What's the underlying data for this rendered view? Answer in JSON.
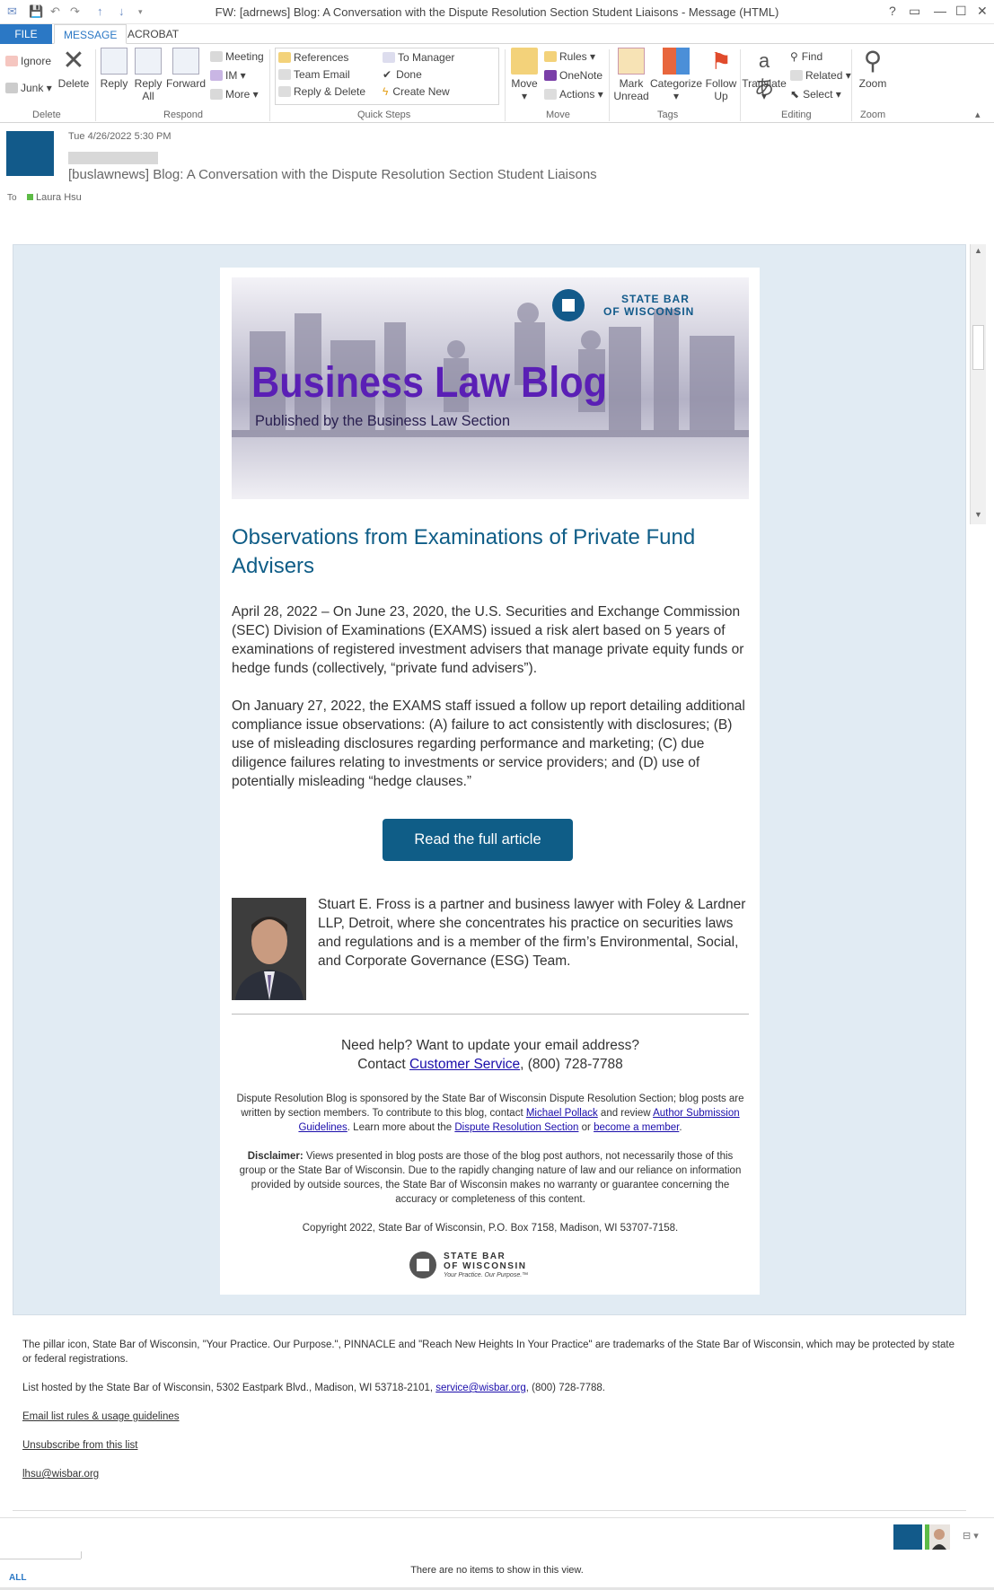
{
  "window": {
    "title": "FW: [adrnews] Blog: A Conversation with the Dispute Resolution Section Student Liaisons - Message (HTML)",
    "controls": [
      "?",
      "▭",
      "—",
      "☐",
      "✕"
    ]
  },
  "tabs": {
    "file": "FILE",
    "message": "MESSAGE",
    "acrobat": "ACROBAT"
  },
  "ribbon": {
    "delete": {
      "ignore": "Ignore",
      "junk": "Junk",
      "delete": "Delete",
      "group": "Delete"
    },
    "respond": {
      "reply": "Reply",
      "reply_all": "Reply All",
      "forward": "Forward",
      "meeting": "Meeting",
      "im": "IM",
      "more": "More",
      "group": "Respond"
    },
    "quick_steps": {
      "items": [
        "References",
        "Team Email",
        "Reply & Delete",
        "To Manager",
        "Done",
        "Create New"
      ],
      "group": "Quick Steps"
    },
    "move": {
      "move": "Move",
      "rules": "Rules",
      "onenote": "OneNote",
      "actions": "Actions",
      "group": "Move"
    },
    "tags": {
      "mark_unread": "Mark Unread",
      "categorize": "Categorize",
      "follow_up": "Follow Up",
      "group": "Tags"
    },
    "editing": {
      "translate": "Translate",
      "find": "Find",
      "related": "Related",
      "select": "Select",
      "group": "Editing"
    },
    "zoom": {
      "zoom": "Zoom",
      "group": "Zoom"
    }
  },
  "message": {
    "date": "Tue 4/26/2022 5:30 PM",
    "subject": "[buslawnews] Blog: A Conversation with the Dispute Resolution Section Student Liaisons",
    "to_label": "To",
    "to": "Laura Hsu"
  },
  "banner": {
    "org_line1": "STATE BAR",
    "org_line2": "OF WISCONSIN",
    "title": "Business Law Blog",
    "subtitle": "Published by the Business Law Section"
  },
  "article": {
    "headline": "Observations from Examinations of Private Fund Advisers",
    "p1": "April 28, 2022 – On June 23, 2020, the U.S. Securities and Exchange Commission (SEC) Division of Examinations (EXAMS) issued a risk alert based on 5 years of examinations of registered investment advisers that manage private equity funds or hedge funds (collectively, “private fund advisers”).",
    "p2": "On January 27, 2022, the EXAMS staff issued a follow up report detailing additional compliance issue observations: (A) failure to act consistently with disclosures; (B) use of misleading disclosures regarding performance and marketing; (C) due diligence failures relating to investments or service providers; and (D) use of potentially misleading “hedge clauses.”",
    "cta": "Read the full article",
    "author_bio": "Stuart E. Fross is a partner and business lawyer with Foley & Lardner LLP, Detroit, where she concentrates his practice on securities laws and regulations and is a member of the firm’s Environmental, Social, and Corporate Governance (ESG) Team."
  },
  "footer": {
    "help_line1": "Need help? Want to update your email address?",
    "help_contact": "Contact ",
    "help_link": "Customer Service",
    "help_phone": ", (800) 728-7788",
    "sponsor_a": "Dispute Resolution Blog is sponsored by the State Bar of Wisconsin Dispute Resolution Section; blog posts are written by section members. To contribute to this blog, contact ",
    "sponsor_link1": "Michael Pollack",
    "sponsor_b": " and review ",
    "sponsor_link2": "Author Submission Guidelines",
    "sponsor_c": ". Learn more about the ",
    "sponsor_link3": "Dispute Resolution Section",
    "sponsor_d": " or ",
    "sponsor_link4": "become a member",
    "sponsor_e": ".",
    "disclaimer_label": "Disclaimer:",
    "disclaimer": " Views presented in blog posts are those of the blog post authors, not necessarily those of this group or the State Bar of Wisconsin. Due to the rapidly changing nature of law and our reliance on information provided by outside sources, the State Bar of Wisconsin makes no warranty or guarantee concerning the accuracy or completeness of this content.",
    "copyright": "Copyright 2022, State Bar of Wisconsin, P.O. Box 7158, Madison, WI 53707-7158.",
    "logo_line1": "STATE BAR",
    "logo_line2": "OF WISCONSIN",
    "logo_tag": "Your Practice. Our Purpose.™"
  },
  "list_footer": {
    "trademark": "The pillar icon, State Bar of Wisconsin, \"Your Practice. Our Purpose.\", PINNACLE and \"Reach New Heights In Your Practice\" are trademarks of the State Bar of Wisconsin, which may be protected by state or federal registrations.",
    "hosted_a": "List hosted by the State Bar of Wisconsin, 5302 Eastpark Blvd., Madison, WI 53718-2101, ",
    "hosted_link": "service@wisbar.org",
    "hosted_b": ", (800) 728-7788.",
    "rules_link": "Email list rules & usage guidelines",
    "unsub_link": "Unsubscribe from this list",
    "email_link": "lhsu@wisbar.org"
  },
  "people_pane": {
    "empty": "There are no items to show in this view.",
    "all": "ALL"
  }
}
